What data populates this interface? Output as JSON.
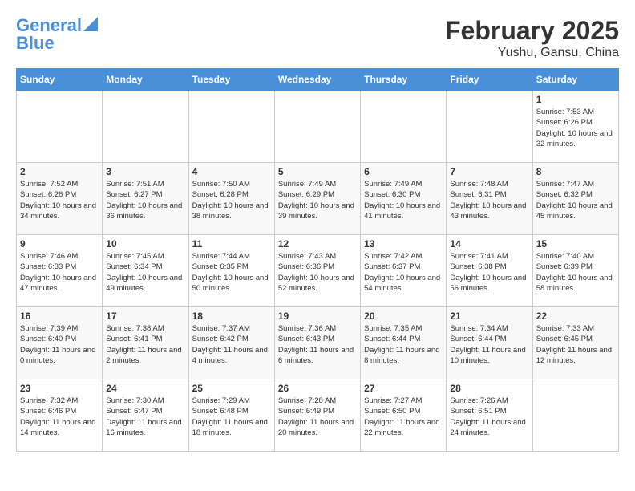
{
  "logo": {
    "line1": "General",
    "line2": "Blue"
  },
  "title": "February 2025",
  "subtitle": "Yushu, Gansu, China",
  "headers": [
    "Sunday",
    "Monday",
    "Tuesday",
    "Wednesday",
    "Thursday",
    "Friday",
    "Saturday"
  ],
  "weeks": [
    [
      {
        "day": "",
        "info": ""
      },
      {
        "day": "",
        "info": ""
      },
      {
        "day": "",
        "info": ""
      },
      {
        "day": "",
        "info": ""
      },
      {
        "day": "",
        "info": ""
      },
      {
        "day": "",
        "info": ""
      },
      {
        "day": "1",
        "info": "Sunrise: 7:53 AM\nSunset: 6:26 PM\nDaylight: 10 hours and 32 minutes."
      }
    ],
    [
      {
        "day": "2",
        "info": "Sunrise: 7:52 AM\nSunset: 6:26 PM\nDaylight: 10 hours and 34 minutes."
      },
      {
        "day": "3",
        "info": "Sunrise: 7:51 AM\nSunset: 6:27 PM\nDaylight: 10 hours and 36 minutes."
      },
      {
        "day": "4",
        "info": "Sunrise: 7:50 AM\nSunset: 6:28 PM\nDaylight: 10 hours and 38 minutes."
      },
      {
        "day": "5",
        "info": "Sunrise: 7:49 AM\nSunset: 6:29 PM\nDaylight: 10 hours and 39 minutes."
      },
      {
        "day": "6",
        "info": "Sunrise: 7:49 AM\nSunset: 6:30 PM\nDaylight: 10 hours and 41 minutes."
      },
      {
        "day": "7",
        "info": "Sunrise: 7:48 AM\nSunset: 6:31 PM\nDaylight: 10 hours and 43 minutes."
      },
      {
        "day": "8",
        "info": "Sunrise: 7:47 AM\nSunset: 6:32 PM\nDaylight: 10 hours and 45 minutes."
      }
    ],
    [
      {
        "day": "9",
        "info": "Sunrise: 7:46 AM\nSunset: 6:33 PM\nDaylight: 10 hours and 47 minutes."
      },
      {
        "day": "10",
        "info": "Sunrise: 7:45 AM\nSunset: 6:34 PM\nDaylight: 10 hours and 49 minutes."
      },
      {
        "day": "11",
        "info": "Sunrise: 7:44 AM\nSunset: 6:35 PM\nDaylight: 10 hours and 50 minutes."
      },
      {
        "day": "12",
        "info": "Sunrise: 7:43 AM\nSunset: 6:36 PM\nDaylight: 10 hours and 52 minutes."
      },
      {
        "day": "13",
        "info": "Sunrise: 7:42 AM\nSunset: 6:37 PM\nDaylight: 10 hours and 54 minutes."
      },
      {
        "day": "14",
        "info": "Sunrise: 7:41 AM\nSunset: 6:38 PM\nDaylight: 10 hours and 56 minutes."
      },
      {
        "day": "15",
        "info": "Sunrise: 7:40 AM\nSunset: 6:39 PM\nDaylight: 10 hours and 58 minutes."
      }
    ],
    [
      {
        "day": "16",
        "info": "Sunrise: 7:39 AM\nSunset: 6:40 PM\nDaylight: 11 hours and 0 minutes."
      },
      {
        "day": "17",
        "info": "Sunrise: 7:38 AM\nSunset: 6:41 PM\nDaylight: 11 hours and 2 minutes."
      },
      {
        "day": "18",
        "info": "Sunrise: 7:37 AM\nSunset: 6:42 PM\nDaylight: 11 hours and 4 minutes."
      },
      {
        "day": "19",
        "info": "Sunrise: 7:36 AM\nSunset: 6:43 PM\nDaylight: 11 hours and 6 minutes."
      },
      {
        "day": "20",
        "info": "Sunrise: 7:35 AM\nSunset: 6:44 PM\nDaylight: 11 hours and 8 minutes."
      },
      {
        "day": "21",
        "info": "Sunrise: 7:34 AM\nSunset: 6:44 PM\nDaylight: 11 hours and 10 minutes."
      },
      {
        "day": "22",
        "info": "Sunrise: 7:33 AM\nSunset: 6:45 PM\nDaylight: 11 hours and 12 minutes."
      }
    ],
    [
      {
        "day": "23",
        "info": "Sunrise: 7:32 AM\nSunset: 6:46 PM\nDaylight: 11 hours and 14 minutes."
      },
      {
        "day": "24",
        "info": "Sunrise: 7:30 AM\nSunset: 6:47 PM\nDaylight: 11 hours and 16 minutes."
      },
      {
        "day": "25",
        "info": "Sunrise: 7:29 AM\nSunset: 6:48 PM\nDaylight: 11 hours and 18 minutes."
      },
      {
        "day": "26",
        "info": "Sunrise: 7:28 AM\nSunset: 6:49 PM\nDaylight: 11 hours and 20 minutes."
      },
      {
        "day": "27",
        "info": "Sunrise: 7:27 AM\nSunset: 6:50 PM\nDaylight: 11 hours and 22 minutes."
      },
      {
        "day": "28",
        "info": "Sunrise: 7:26 AM\nSunset: 6:51 PM\nDaylight: 11 hours and 24 minutes."
      },
      {
        "day": "",
        "info": ""
      }
    ]
  ]
}
